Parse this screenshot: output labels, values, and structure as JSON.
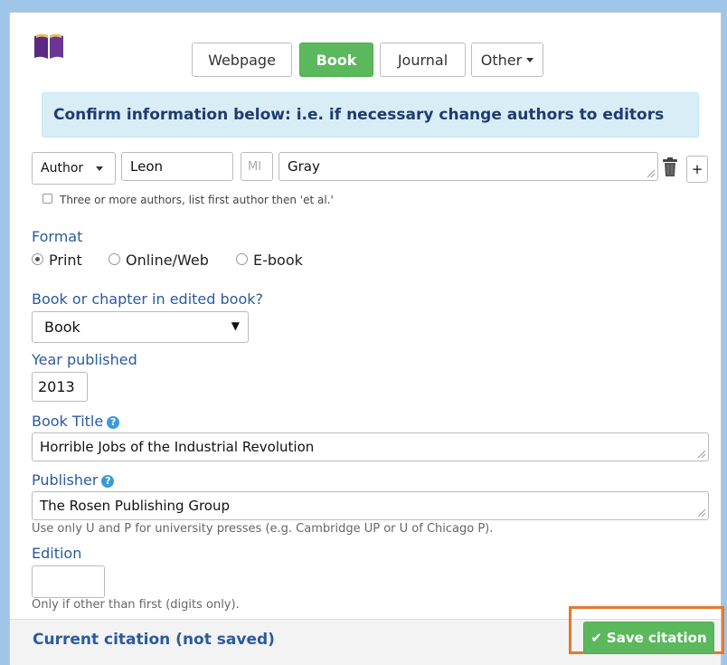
{
  "tabs": [
    {
      "label": "Webpage"
    },
    {
      "label": "Book",
      "active": true
    },
    {
      "label": "Journal"
    },
    {
      "label": "Other"
    }
  ],
  "info_message": "Confirm information below: i.e. if necessary change authors to editors",
  "author": {
    "role": "Author",
    "first": "Leon",
    "mi_placeholder": "MI",
    "last": "Gray",
    "add_label": "+",
    "et_al_label": "Three or more authors, list first author then 'et al.'"
  },
  "format": {
    "label": "Format",
    "options": [
      "Print",
      "Online/Web",
      "E-book"
    ],
    "selected": "Print"
  },
  "book_type": {
    "label": "Book or chapter in edited book?",
    "value": "Book"
  },
  "year": {
    "label": "Year published",
    "value": "2013"
  },
  "title": {
    "label": "Book Title",
    "value": "Horrible Jobs of the Industrial Revolution"
  },
  "publisher": {
    "label": "Publisher",
    "value": "The Rosen Publishing Group",
    "hint": "Use only U and P for university presses (e.g. Cambridge UP or U of Chicago P)."
  },
  "edition": {
    "label": "Edition",
    "value": "",
    "hint": "Only if other than first (digits only)."
  },
  "footer": {
    "title": "Current citation (not saved)",
    "save_label": "Save citation"
  },
  "colors": {
    "accent_green": "#5cb85c",
    "label_blue": "#2a5aa0",
    "highlight_orange": "#e8782a",
    "background": "#9fc5e8"
  }
}
